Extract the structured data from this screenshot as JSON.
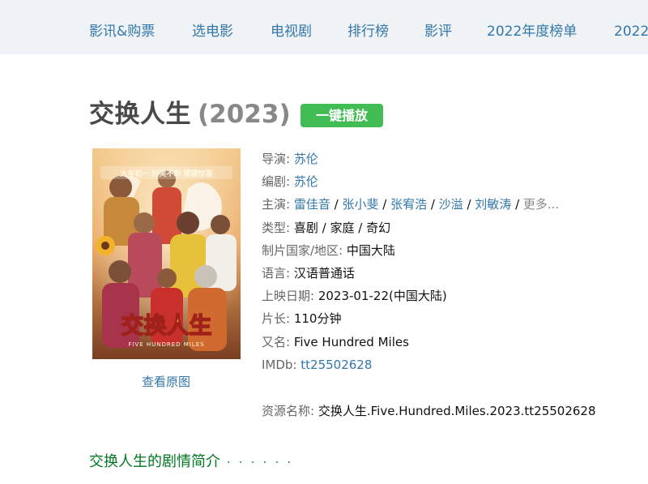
{
  "nav": {
    "items": [
      "影讯&购票",
      "选电影",
      "电视剧",
      "排行榜",
      "影评",
      "2022年度榜单",
      "2022"
    ]
  },
  "movie": {
    "title": "交换人生",
    "year": "(2023)",
    "play_button": "一键播放",
    "poster_alt": "交换人生 海报",
    "view_original": "查看原图"
  },
  "info": {
    "director_label": "导演",
    "director": "苏伦",
    "writer_label": "编剧",
    "writer": "苏伦",
    "cast_label": "主演",
    "cast": [
      "雷佳音",
      "张小斐",
      "张宥浩",
      "沙溢",
      "刘敏涛"
    ],
    "cast_more": "更多...",
    "genre_label": "类型",
    "genres": [
      "喜剧",
      "家庭",
      "奇幻"
    ],
    "country_label": "制片国家/地区",
    "country": "中国大陆",
    "language_label": "语言",
    "language": "汉语普通话",
    "release_label": "上映日期",
    "release": "2023-01-22(中国大陆)",
    "runtime_label": "片长",
    "runtime": "110分钟",
    "aka_label": "又名",
    "aka": "Five Hundred Miles",
    "imdb_label": "IMDb",
    "imdb": "tt25502628"
  },
  "resource": {
    "label": "资源名称",
    "name": "交换人生.Five.Hundred.Miles.2023.tt25502628"
  },
  "intro": {
    "heading": "交换人生的剧情简介",
    "dots": "· · · · · ·"
  },
  "poster_text": {
    "top_banner": "大年初一 好笑不断 暖暖惊喜",
    "logo": "交换人生",
    "subtitle": "FIVE HUNDRED MILES"
  },
  "colors": {
    "link": "#3377aa",
    "play_green": "#42bd56",
    "intro_green": "#007722",
    "nav_bg": "#f0f3f5"
  }
}
